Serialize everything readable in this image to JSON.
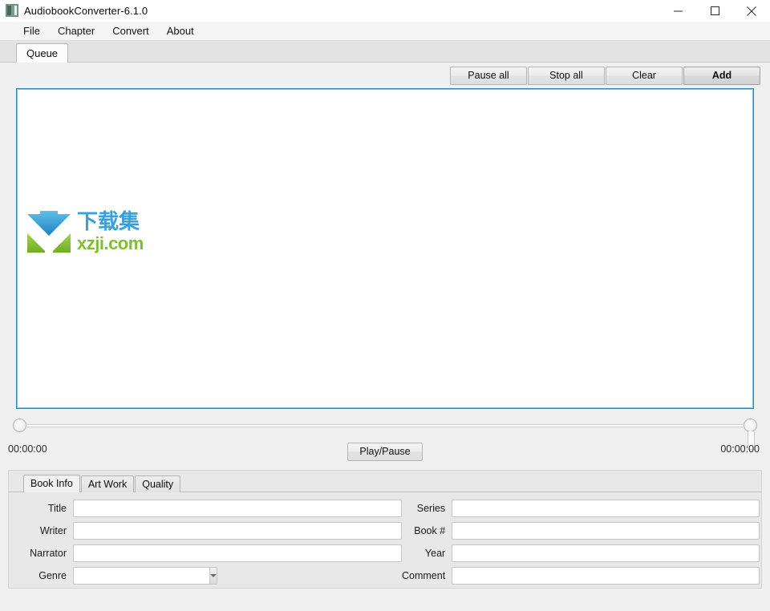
{
  "window": {
    "title": "AudiobookConverter-6.1.0",
    "icon": "app-icon",
    "controls": {
      "minimize": "minimize-icon",
      "maximize": "maximize-icon",
      "close": "close-icon"
    }
  },
  "menubar": {
    "items": [
      {
        "label": "File"
      },
      {
        "label": "Chapter"
      },
      {
        "label": "Convert"
      },
      {
        "label": "About"
      }
    ]
  },
  "top_tabs": [
    {
      "label": "Queue",
      "active": true
    }
  ],
  "toolbar": {
    "buttons": [
      {
        "label": "Pause all",
        "default": false
      },
      {
        "label": "Stop all",
        "default": false
      },
      {
        "label": "Clear",
        "default": false
      },
      {
        "label": "Add",
        "default": true
      }
    ]
  },
  "queue": {
    "items": [],
    "empty": true,
    "border_color": "#2e8ab5",
    "watermark": {
      "cn": "下载集",
      "en": "xzji.com",
      "logo_blue": "#3aa0d8",
      "logo_green": "#8cc63f"
    }
  },
  "transport": {
    "time_start": "00:00:00",
    "time_end": "00:00:00",
    "play_pause_label": "Play/Pause",
    "slider_left_value": 0,
    "slider_right_value": 100
  },
  "bottom_tabs": [
    {
      "label": "Book Info",
      "active": true
    },
    {
      "label": "Art Work",
      "active": false
    },
    {
      "label": "Quality",
      "active": false
    }
  ],
  "book_info": {
    "left": [
      {
        "label": "Title",
        "value": "",
        "placeholder": "",
        "type": "text"
      },
      {
        "label": "Writer",
        "value": "",
        "placeholder": "",
        "type": "text"
      },
      {
        "label": "Narrator",
        "value": "",
        "placeholder": "",
        "type": "text"
      },
      {
        "label": "Genre",
        "value": "",
        "placeholder": "",
        "type": "combo"
      }
    ],
    "right": [
      {
        "label": "Series",
        "value": "",
        "placeholder": "",
        "type": "text"
      },
      {
        "label": "Book #",
        "value": "",
        "placeholder": "",
        "type": "text"
      },
      {
        "label": "Year",
        "value": "",
        "placeholder": "",
        "type": "text"
      },
      {
        "label": "Comment",
        "value": "",
        "placeholder": "",
        "type": "text"
      }
    ]
  }
}
